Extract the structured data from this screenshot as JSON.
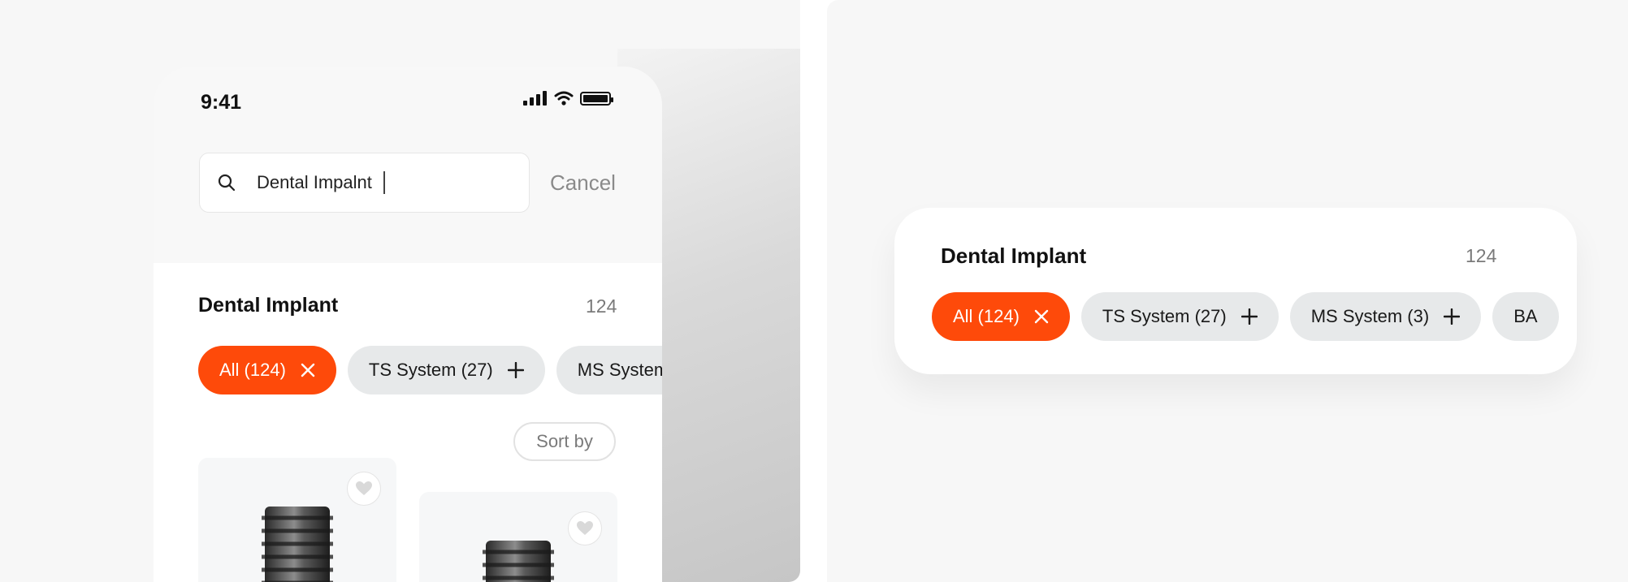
{
  "phone": {
    "status_time": "9:41",
    "search": {
      "value": "Dental Impalnt",
      "cancel_label": "Cancel"
    },
    "section": {
      "title": "Dental Implant",
      "count": "124"
    },
    "chips": [
      {
        "label": "All (124)",
        "active": true
      },
      {
        "label": "TS System (27)",
        "active": false
      },
      {
        "label": "MS System",
        "active": false
      }
    ],
    "sort_label": "Sort by"
  },
  "filter_card": {
    "title": "Dental Implant",
    "count": "124",
    "chips": [
      {
        "label": "All (124)",
        "active": true
      },
      {
        "label": "TS System (27)",
        "active": false
      },
      {
        "label": "MS System (3)",
        "active": false
      },
      {
        "label": "BA",
        "active": false
      }
    ]
  },
  "icons": {
    "signal": "cellular-signal-icon",
    "wifi": "wifi-icon",
    "battery": "battery-icon",
    "search": "search-icon",
    "close": "close-icon",
    "plus": "plus-icon",
    "heart": "heart-icon"
  },
  "colors": {
    "accent": "#fe4a0a",
    "chip_bg": "#e7e9ea",
    "background": "#f7f7f7"
  }
}
